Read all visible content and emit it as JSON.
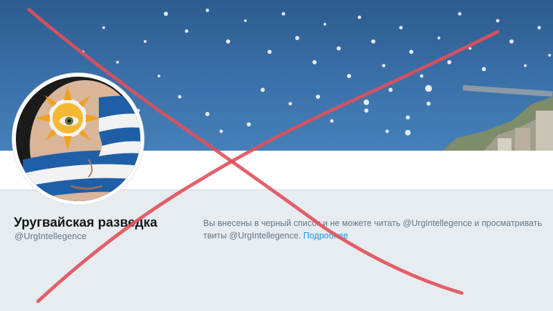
{
  "profile": {
    "display_name": "Уругвайская разведка",
    "handle": "@UrgIntellegence"
  },
  "blocked_notice": {
    "text": "Вы внесены в черный список и не можете читать @UrgIntellegence и просматривать твиты @UrgIntellegence.",
    "link_label": "Подробнее"
  },
  "colors": {
    "link": "#1b95e0",
    "cross": "#e0505a",
    "banner_sea": "#3a6ea6"
  },
  "icons": {
    "overlay": "red-cross-mark"
  }
}
